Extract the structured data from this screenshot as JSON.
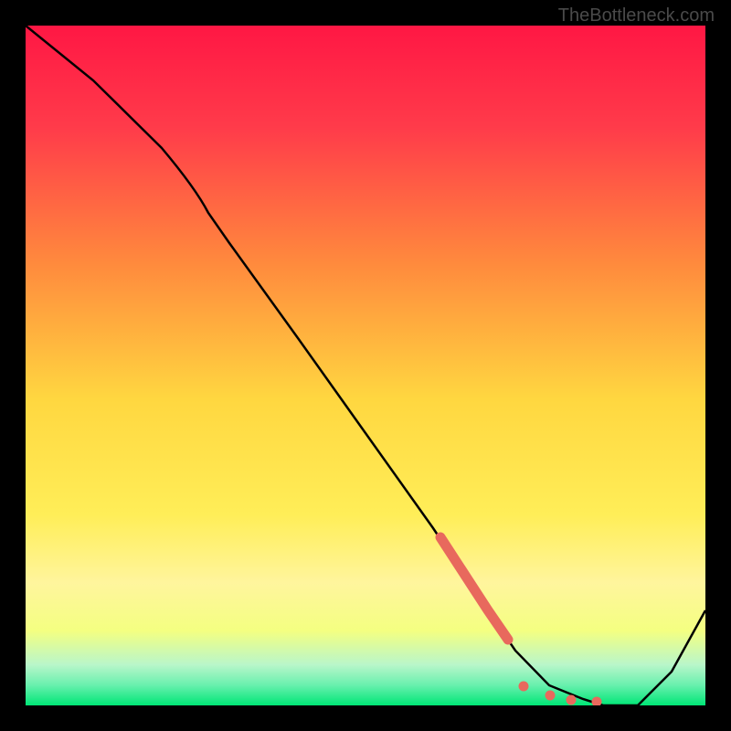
{
  "watermark": "TheBottleneck.com",
  "chart_data": {
    "type": "line",
    "title": "",
    "xlabel": "",
    "ylabel": "",
    "xlim": [
      0,
      100
    ],
    "ylim": [
      0,
      100
    ],
    "series": [
      {
        "name": "bottleneck-curve",
        "x": [
          0,
          10,
          20,
          25,
          30,
          40,
          50,
          60,
          68,
          72,
          77,
          82,
          85,
          90,
          95,
          100
        ],
        "y": [
          100,
          92,
          82,
          76,
          68,
          54,
          40,
          26,
          14,
          8,
          3,
          1,
          0,
          0,
          5,
          14
        ],
        "color": "#000000"
      }
    ],
    "markers": [
      {
        "name": "highlight-band",
        "x_range": [
          61,
          70
        ],
        "style": "thick-coral-stroke",
        "color": "#e8695d"
      },
      {
        "name": "dot-1",
        "x": 73,
        "y": 2.5,
        "color": "#e8695d"
      },
      {
        "name": "dot-2",
        "x": 77,
        "y": 1.2,
        "color": "#e8695d"
      },
      {
        "name": "dot-3",
        "x": 80,
        "y": 0.8,
        "color": "#e8695d"
      },
      {
        "name": "dot-4",
        "x": 84,
        "y": 0.5,
        "color": "#e8695d"
      }
    ],
    "background_gradient": {
      "type": "vertical",
      "stops": [
        {
          "offset": 0,
          "color": "#ff1744"
        },
        {
          "offset": 15,
          "color": "#ff3b4a"
        },
        {
          "offset": 35,
          "color": "#ff8a3d"
        },
        {
          "offset": 55,
          "color": "#ffd740"
        },
        {
          "offset": 72,
          "color": "#ffee58"
        },
        {
          "offset": 82,
          "color": "#fff59d"
        },
        {
          "offset": 89,
          "color": "#f4ff81"
        },
        {
          "offset": 94,
          "color": "#b9f6ca"
        },
        {
          "offset": 97,
          "color": "#69f0ae"
        },
        {
          "offset": 100,
          "color": "#00e676"
        }
      ]
    }
  }
}
